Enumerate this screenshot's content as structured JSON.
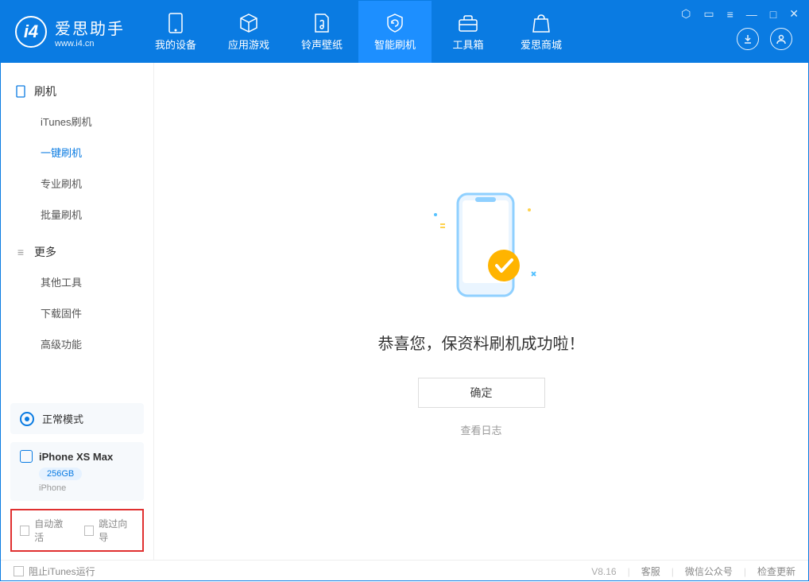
{
  "app": {
    "title": "爱思助手",
    "subtitle": "www.i4.cn"
  },
  "nav": [
    {
      "label": "我的设备"
    },
    {
      "label": "应用游戏"
    },
    {
      "label": "铃声壁纸"
    },
    {
      "label": "智能刷机",
      "active": true
    },
    {
      "label": "工具箱"
    },
    {
      "label": "爱思商城"
    }
  ],
  "sidebar": {
    "section1_title": "刷机",
    "items1": [
      {
        "label": "iTunes刷机"
      },
      {
        "label": "一键刷机",
        "active": true
      },
      {
        "label": "专业刷机"
      },
      {
        "label": "批量刷机"
      }
    ],
    "section2_title": "更多",
    "items2": [
      {
        "label": "其他工具"
      },
      {
        "label": "下载固件"
      },
      {
        "label": "高级功能"
      }
    ]
  },
  "mode": {
    "label": "正常模式"
  },
  "device": {
    "name": "iPhone XS Max",
    "capacity": "256GB",
    "type": "iPhone"
  },
  "checkboxes": {
    "auto_activate": "自动激活",
    "skip_guide": "跳过向导"
  },
  "main": {
    "message": "恭喜您，保资料刷机成功啦！",
    "ok": "确定",
    "view_log": "查看日志"
  },
  "footer": {
    "block_itunes": "阻止iTunes运行",
    "version": "V8.16",
    "support": "客服",
    "wechat": "微信公众号",
    "update": "检查更新"
  }
}
